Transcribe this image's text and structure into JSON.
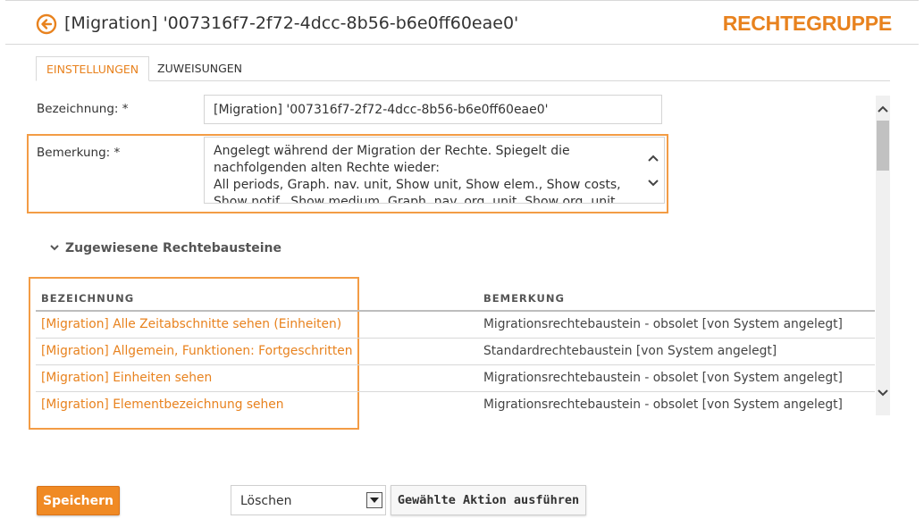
{
  "header": {
    "title": "[Migration] '007316f7-2f72-4dcc-8b56-b6e0ff60eae0'",
    "page_type": "RECHTEGRUPPE",
    "accent": "#e8821e"
  },
  "tabs": [
    {
      "label": "EINSTELLUNGEN",
      "active": true
    },
    {
      "label": "ZUWEISUNGEN",
      "active": false
    }
  ],
  "form": {
    "bezeichnung_label": "Bezeichnung: *",
    "bezeichnung_value": "[Migration] '007316f7-2f72-4dcc-8b56-b6e0ff60eae0'",
    "bemerkung_label": "Bemerkung: *",
    "bemerkung_value": "Angelegt während der Migration der Rechte. Spiegelt die nachfolgenden alten Rechte wieder:\nAll periods, Graph. nav. unit, Show unit, Show elem., Show costs, Show notif., Show medium, Graph. nav. org. unit, Show org. unit, Stat. show"
  },
  "section": {
    "title": "Zugewiesene Rechtebausteine"
  },
  "table": {
    "headers": [
      "BEZEICHNUNG",
      "BEMERKUNG"
    ],
    "rows": [
      {
        "name": "[Migration] Alle Zeitabschnitte sehen (Einheiten)",
        "bemerkung": "Migrationsrechtebaustein - obsolet [von System angelegt]"
      },
      {
        "name": "[Migration] Allgemein, Funktionen: Fortgeschritten",
        "bemerkung": "Standardrechtebaustein [von System angelegt]"
      },
      {
        "name": "[Migration] Einheiten sehen",
        "bemerkung": "Migrationsrechtebaustein - obsolet [von System angelegt]"
      },
      {
        "name": "[Migration] Elementbezeichnung sehen",
        "bemerkung": "Migrationsrechtebaustein - obsolet [von System angelegt]"
      }
    ]
  },
  "footer": {
    "save_label": "Speichern",
    "action_select_value": "Löschen",
    "action_button_label": "Gewählte Aktion ausführen"
  },
  "icons": {
    "back": "back-arrow-circle-icon",
    "collapse": "chevron-down-icon"
  }
}
